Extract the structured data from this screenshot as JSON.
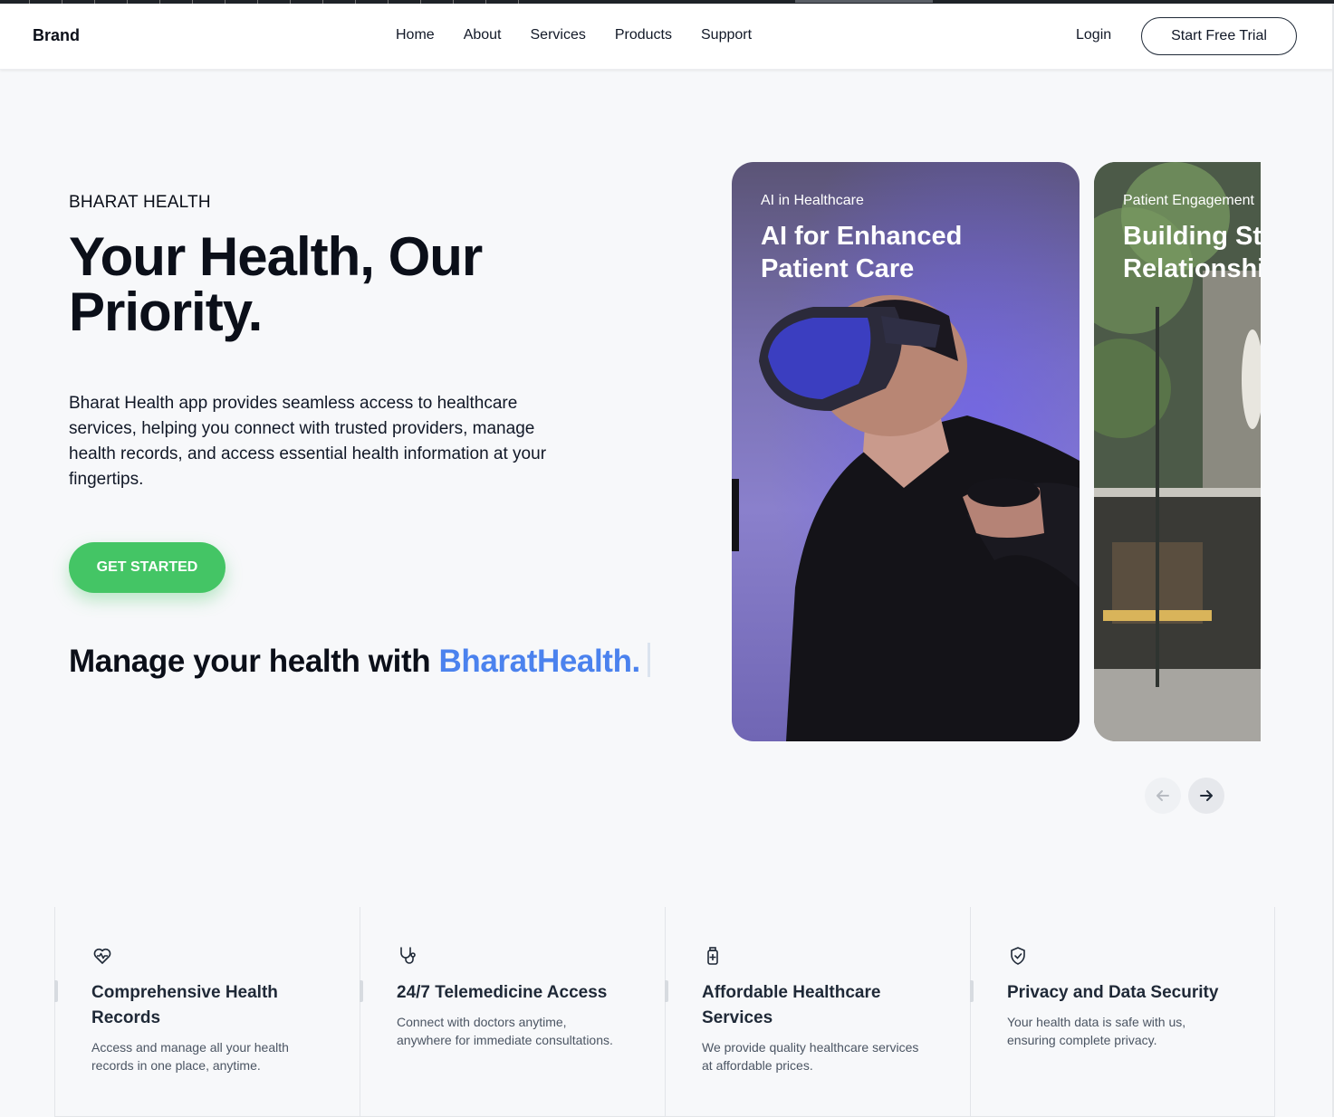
{
  "header": {
    "brand": "Brand",
    "nav": [
      "Home",
      "About",
      "Services",
      "Products",
      "Support"
    ],
    "login": "Login",
    "cta": "Start Free Trial"
  },
  "hero": {
    "eyebrow": "BHARAT HEALTH",
    "title": "Your Health, Our Priority.",
    "description": "Bharat Health app provides seamless access to healthcare services, helping you connect with trusted providers, manage health records, and access essential health information at your fingertips.",
    "button": "GET STARTED",
    "tagline_prefix": "Manage your health with ",
    "tagline_accent": "BharatHealth."
  },
  "carousel": {
    "cards": [
      {
        "category": "AI in Healthcare",
        "title": "AI for Enhanced Patient Care"
      },
      {
        "category": "Patient Engagement",
        "title": "Building Strong Patient Relationships"
      }
    ],
    "prev_icon": "arrow-left-icon",
    "next_icon": "arrow-right-icon"
  },
  "features": [
    {
      "icon": "heart-pulse-icon",
      "title": "Comprehensive Health Records",
      "text": "Access and manage all your health records in one place, anytime."
    },
    {
      "icon": "stethoscope-icon",
      "title": "24/7 Telemedicine Access",
      "text": "Connect with doctors anytime, anywhere for immediate consultations."
    },
    {
      "icon": "medicine-bottle-icon",
      "title": "Affordable Healthcare Services",
      "text": "We provide quality healthcare services at affordable prices."
    },
    {
      "icon": "shield-check-icon",
      "title": "Privacy and Data Security",
      "text": "Your health data is safe with us, ensuring complete privacy."
    }
  ],
  "colors": {
    "accent_green": "#44c565",
    "accent_blue": "#4b82ee",
    "text_dark": "#0b0f19",
    "background": "#f7f8fa"
  }
}
